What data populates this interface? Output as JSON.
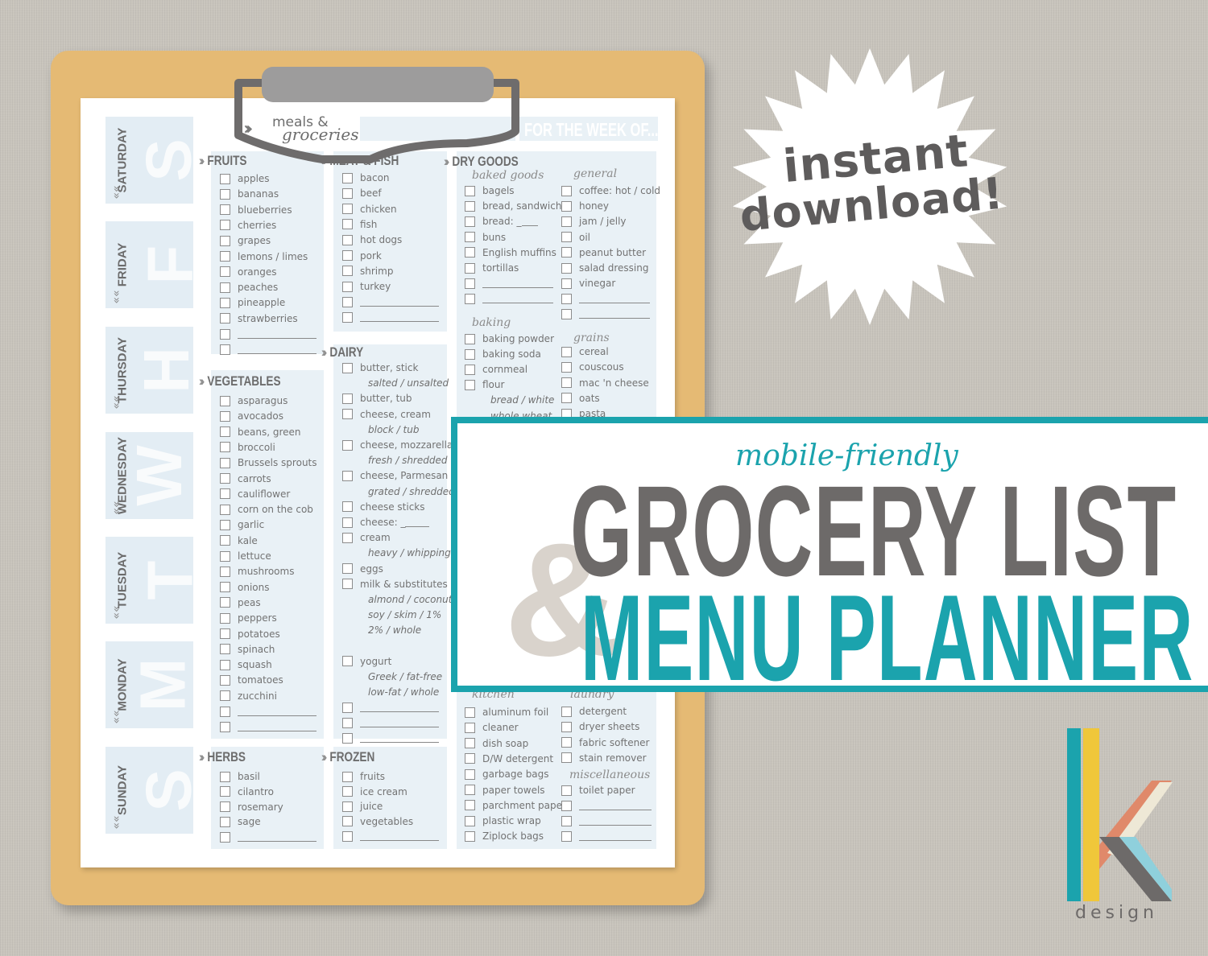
{
  "colors": {
    "teal": "#1ba3ad",
    "gray": "#6d6a69",
    "clipboard": "#e5ba74",
    "panel": "#e9f1f6",
    "ampersand": "#d9d3cc"
  },
  "planner": {
    "logo_line1": "meals &",
    "logo_line2": "groceries",
    "week_label": "FOR THE WEEK OF...",
    "days": [
      {
        "label": "SATURDAY",
        "letter": "S"
      },
      {
        "label": "FRIDAY",
        "letter": "F"
      },
      {
        "label": "THURSDAY",
        "letter": "H"
      },
      {
        "label": "WEDNESDAY",
        "letter": "W"
      },
      {
        "label": "TUESDAY",
        "letter": "T"
      },
      {
        "label": "MONDAY",
        "letter": "M"
      },
      {
        "label": "SUNDAY",
        "letter": "S"
      }
    ],
    "sections": {
      "fruits": {
        "title": "FRUITS",
        "items": [
          "apples",
          "bananas",
          "blueberries",
          "cherries",
          "grapes",
          "lemons / limes",
          "oranges",
          "peaches",
          "pineapple",
          "strawberries",
          "",
          ""
        ]
      },
      "vegetables": {
        "title": "VEGETABLES",
        "items": [
          "asparagus",
          "avocados",
          "beans, green",
          "broccoli",
          "Brussels sprouts",
          "carrots",
          "cauliflower",
          "corn on the cob",
          "garlic",
          "kale",
          "lettuce",
          "mushrooms",
          "onions",
          "peas",
          "peppers",
          "potatoes",
          "spinach",
          "squash",
          "tomatoes",
          "zucchini",
          "",
          ""
        ]
      },
      "herbs": {
        "title": "HERBS",
        "items": [
          "basil",
          "cilantro",
          "rosemary",
          "sage",
          ""
        ]
      },
      "meat": {
        "title": "MEAT & FISH",
        "items": [
          "bacon",
          "beef",
          "chicken",
          "fish",
          "hot dogs",
          "pork",
          "shrimp",
          "turkey",
          "",
          ""
        ]
      },
      "dairy": {
        "title": "DAIRY",
        "items": [
          "butter, stick",
          "~salted / unsalted",
          "butter, tub",
          "cheese, cream",
          "~block / tub",
          "cheese, mozzarella",
          "~fresh / shredded",
          "cheese, Parmesan",
          "~grated / shredded",
          "cheese sticks",
          "cheese: _",
          "cream",
          "~heavy / whipping",
          "eggs",
          "milk & substitutes",
          "~almond / coconut",
          "~soy / skim / 1%",
          "~2% / whole",
          "~ ",
          "yogurt",
          "~Greek / fat-free",
          "~low-fat / whole",
          "",
          "",
          ""
        ]
      },
      "frozen": {
        "title": "FROZEN",
        "items": [
          "fruits",
          "ice cream",
          "juice",
          "vegetables",
          ""
        ]
      },
      "dry_goods": {
        "title": "DRY GOODS"
      },
      "baked_goods": {
        "title": "baked goods",
        "items": [
          "bagels",
          "bread, sandwich",
          "bread: _",
          "buns",
          "English muffins",
          "tortillas",
          "",
          ""
        ]
      },
      "general": {
        "title": "general",
        "items": [
          "coffee: hot / cold",
          "honey",
          "jam / jelly",
          "oil",
          "peanut butter",
          "salad dressing",
          "vinegar",
          "",
          ""
        ]
      },
      "baking": {
        "title": "baking",
        "items": [
          "baking powder",
          "baking soda",
          "cornmeal",
          "flour",
          "~bread / white",
          "~whole wheat"
        ]
      },
      "grains": {
        "title": "grains",
        "items": [
          "cereal",
          "couscous",
          "mac 'n cheese",
          "oats",
          "pasta"
        ]
      },
      "kitchen": {
        "title": "kitchen",
        "items": [
          "aluminum foil",
          "cleaner",
          "dish soap",
          "D/W detergent",
          "garbage bags",
          "paper towels",
          "parchment paper",
          "plastic wrap",
          "Ziplock bags"
        ]
      },
      "laundry": {
        "title": "laundry",
        "items": [
          "detergent",
          "dryer sheets",
          "fabric softener",
          "stain remover"
        ]
      },
      "miscellaneous": {
        "title": "miscellaneous",
        "items": [
          "toilet paper",
          "",
          "",
          ""
        ]
      }
    }
  },
  "badge": {
    "line1": "instant",
    "line2": "download!"
  },
  "banner": {
    "tagline": "mobile-friendly",
    "line1": "GROCERY LIST",
    "ampersand": "&",
    "line2": "MENU PLANNER"
  },
  "brand": {
    "word": "design"
  }
}
